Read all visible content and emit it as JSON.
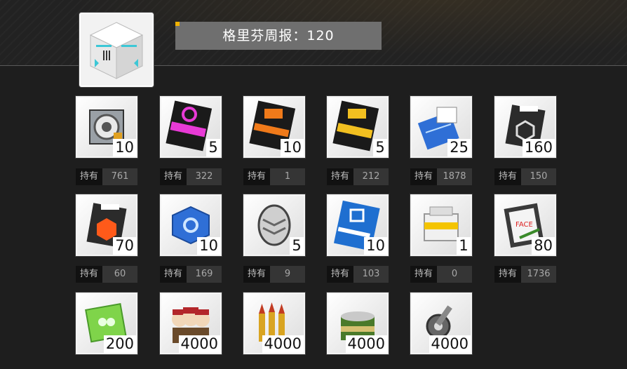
{
  "header": {
    "title": "格里芬周报：120"
  },
  "owned_label": "持有",
  "items": [
    {
      "icon": "central-data-unit-icon",
      "qty": "10",
      "owned": "761"
    },
    {
      "icon": "magenta-training-card-icon",
      "qty": "5",
      "owned": "322"
    },
    {
      "icon": "orange-training-card-icon",
      "qty": "10",
      "owned": "1"
    },
    {
      "icon": "yellow-training-card-icon",
      "qty": "5",
      "owned": "212"
    },
    {
      "icon": "blueprint-icon",
      "qty": "25",
      "owned": "1878"
    },
    {
      "icon": "wave-black-chip-icon",
      "qty": "160",
      "owned": "150"
    },
    {
      "icon": "wave-orange-chip-icon",
      "qty": "70",
      "owned": "60"
    },
    {
      "icon": "blue-gear-box-icon",
      "qty": "10",
      "owned": "169"
    },
    {
      "icon": "silver-token-icon",
      "qty": "5",
      "owned": "9"
    },
    {
      "icon": "blue-data-card-icon",
      "qty": "10",
      "owned": "103"
    },
    {
      "icon": "supply-crate-icon",
      "qty": "1",
      "owned": "0"
    },
    {
      "icon": "clipboard-contract-icon",
      "qty": "80",
      "owned": "1736"
    },
    {
      "icon": "green-voucher-icon",
      "qty": "200"
    },
    {
      "icon": "dolls-squad-icon",
      "qty": "4000"
    },
    {
      "icon": "ammo-icon",
      "qty": "4000"
    },
    {
      "icon": "ration-can-icon",
      "qty": "4000"
    },
    {
      "icon": "parts-wrench-icon",
      "qty": "4000"
    }
  ]
}
